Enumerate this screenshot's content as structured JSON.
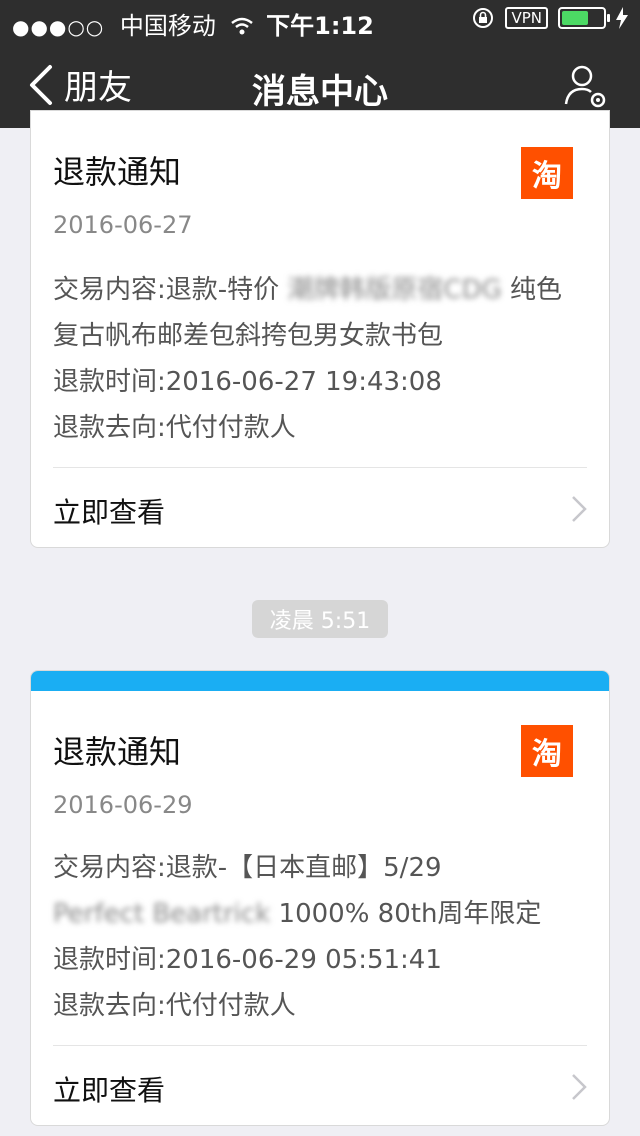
{
  "status_bar": {
    "signal": "●●●○○",
    "carrier": "中国移动",
    "time": "下午1:12",
    "vpn": "VPN"
  },
  "nav": {
    "back_label": "朋友",
    "title": "消息中心"
  },
  "messages": [
    {
      "title": "退款通知",
      "badge": "淘",
      "date": "2016-06-27",
      "content_prefix": "交易内容:退款-特价",
      "content_blurred": "潮牌韩版原宿CDG",
      "content_suffix": "纯色复古帆布邮差包斜挎包男女款书包",
      "refund_time": "退款时间:2016-06-27 19:43:08",
      "refund_to": "退款去向:代付付款人",
      "action": "立即查看"
    },
    {
      "title": "退款通知",
      "badge": "淘",
      "date": "2016-06-29",
      "content_prefix": "交易内容:退款-【日本直邮】5/29",
      "content_blurred": "Perfect Beartrick",
      "content_suffix": "1000% 80th周年限定",
      "refund_time": "退款时间:2016-06-29 05:51:41",
      "refund_to": "退款去向:代付付款人",
      "action": "立即查看"
    }
  ],
  "timestamp_separator": "凌晨 5:51",
  "colors": {
    "nav_bg": "#2e2e2e",
    "accent": "#1aaef3",
    "taobao": "#ff5000"
  }
}
